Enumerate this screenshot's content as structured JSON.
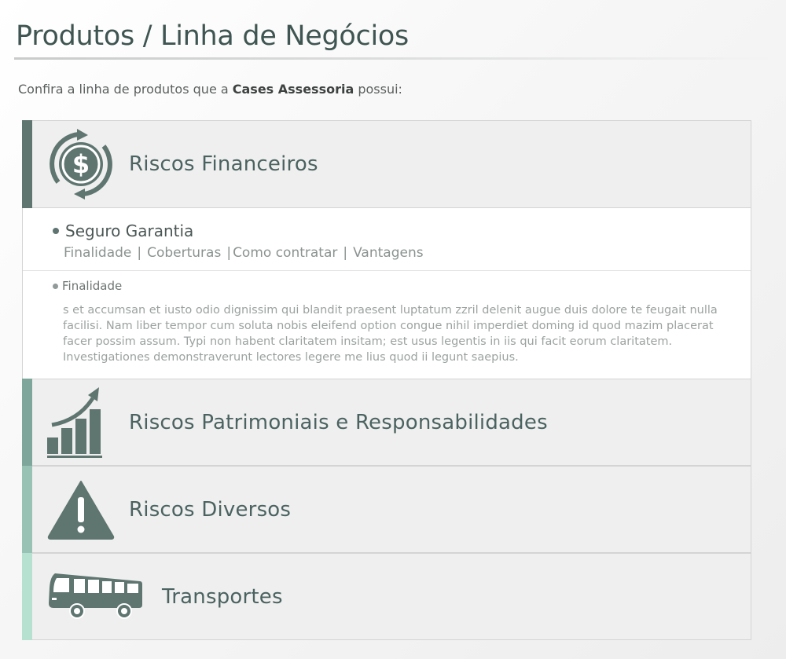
{
  "page": {
    "title": "Produtos / Linha de Negócios",
    "intro_prefix": "Confira a linha de produtos que a ",
    "intro_company": "Cases Assessoria",
    "intro_suffix": " possui:"
  },
  "colors": {
    "accent_dark": "#5f7570",
    "accent_mid": "#7fa69a",
    "accent_light": "#98c2b3",
    "accent_pale": "#b6e0d0",
    "icon": "#5f7570"
  },
  "categories": [
    {
      "label": "Riscos Financeiros",
      "icon": "dollar-cycle-icon",
      "expanded": true,
      "products": [
        {
          "title": "Seguro Garantia",
          "links": [
            "Finalidade",
            "Coberturas",
            "Como contratar",
            "Vantagens"
          ],
          "detail": {
            "title": "Finalidade",
            "text": "s et accumsan et iusto odio dignissim qui blandit praesent luptatum zzril delenit augue duis dolore te feugait nulla facilisi. Nam liber tempor cum soluta nobis eleifend option congue nihil imperdiet doming id quod mazim placerat facer possim assum. Typi non habent claritatem insitam; est usus legentis in iis qui facit eorum claritatem. Investigationes demonstraverunt lectores legere me lius quod ii legunt saepius."
          }
        }
      ]
    },
    {
      "label": "Riscos Patrimoniais e Responsabilidades",
      "icon": "growth-chart-icon",
      "expanded": false
    },
    {
      "label": "Riscos Diversos",
      "icon": "warning-icon",
      "expanded": false
    },
    {
      "label": "Transportes",
      "icon": "bus-icon",
      "expanded": false
    }
  ]
}
